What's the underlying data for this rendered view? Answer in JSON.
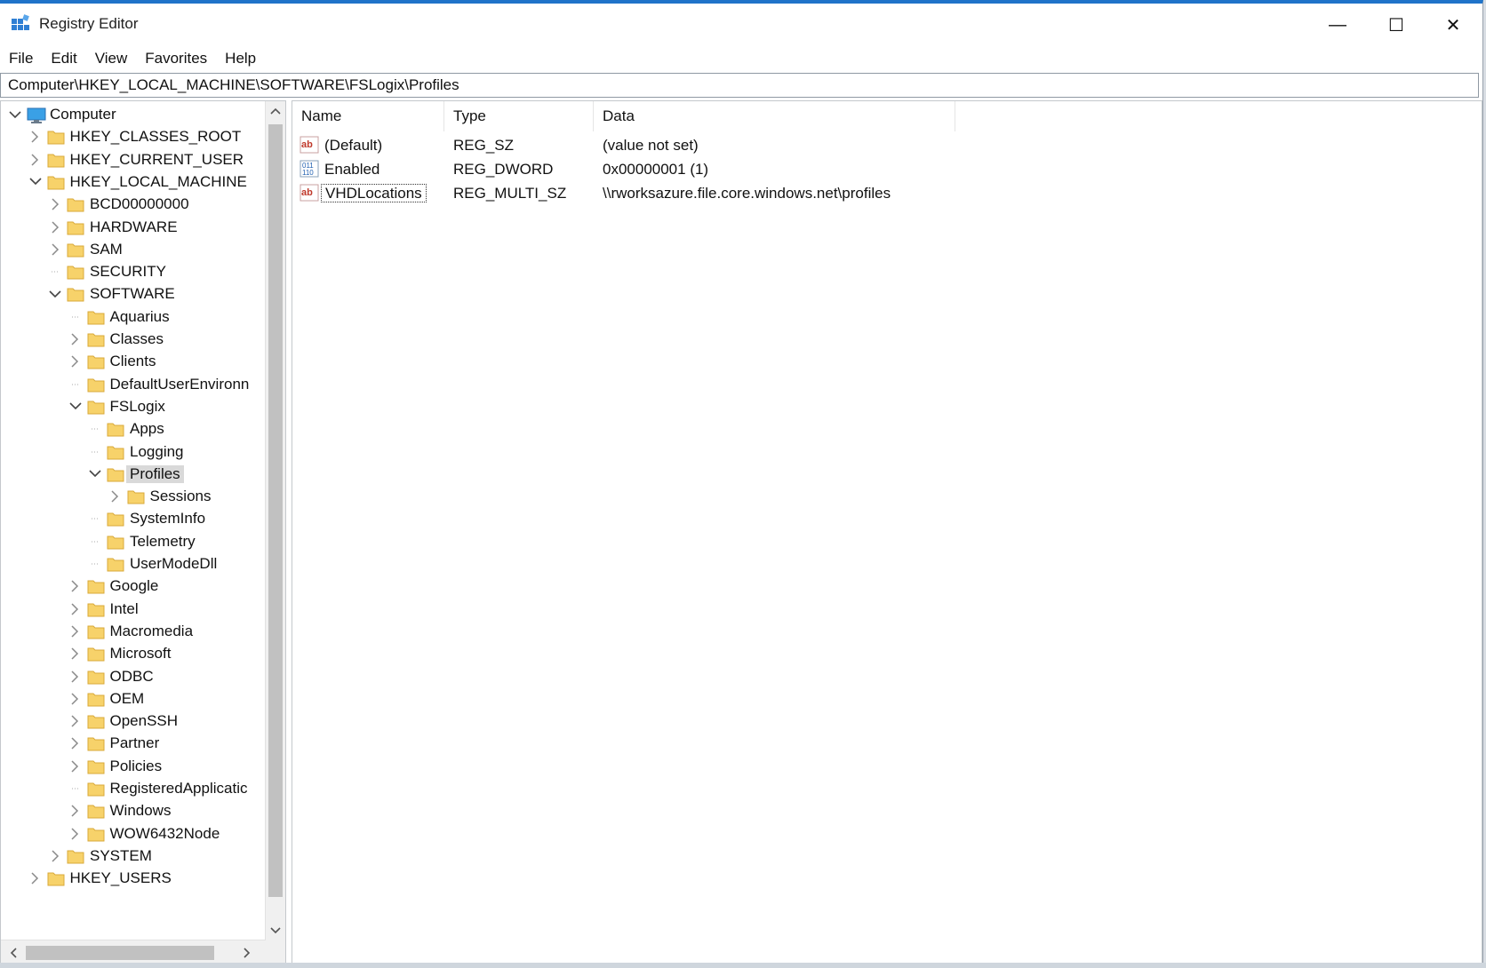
{
  "window": {
    "title": "Registry Editor",
    "controls": {
      "minimize": "—",
      "maximize": "☐",
      "close": "✕"
    }
  },
  "menu": [
    "File",
    "Edit",
    "View",
    "Favorites",
    "Help"
  ],
  "address": "Computer\\HKEY_LOCAL_MACHINE\\SOFTWARE\\FSLogix\\Profiles",
  "tree": [
    {
      "label": "Computer",
      "depth": 0,
      "state": "expanded",
      "icon": "computer-icon"
    },
    {
      "label": "HKEY_CLASSES_ROOT",
      "depth": 1,
      "state": "collapsed",
      "icon": "folder-icon"
    },
    {
      "label": "HKEY_CURRENT_USER",
      "depth": 1,
      "state": "collapsed",
      "icon": "folder-icon"
    },
    {
      "label": "HKEY_LOCAL_MACHINE",
      "depth": 1,
      "state": "expanded",
      "icon": "folder-icon"
    },
    {
      "label": "BCD00000000",
      "depth": 2,
      "state": "collapsed",
      "icon": "folder-icon"
    },
    {
      "label": "HARDWARE",
      "depth": 2,
      "state": "collapsed",
      "icon": "folder-icon"
    },
    {
      "label": "SAM",
      "depth": 2,
      "state": "collapsed",
      "icon": "folder-icon"
    },
    {
      "label": "SECURITY",
      "depth": 2,
      "state": "leaf",
      "icon": "folder-icon"
    },
    {
      "label": "SOFTWARE",
      "depth": 2,
      "state": "expanded",
      "icon": "folder-icon"
    },
    {
      "label": "Aquarius",
      "depth": 3,
      "state": "leaf",
      "icon": "folder-icon"
    },
    {
      "label": "Classes",
      "depth": 3,
      "state": "collapsed",
      "icon": "folder-icon"
    },
    {
      "label": "Clients",
      "depth": 3,
      "state": "collapsed",
      "icon": "folder-icon"
    },
    {
      "label": "DefaultUserEnvironn",
      "depth": 3,
      "state": "leaf",
      "icon": "folder-icon"
    },
    {
      "label": "FSLogix",
      "depth": 3,
      "state": "expanded",
      "icon": "folder-icon"
    },
    {
      "label": "Apps",
      "depth": 4,
      "state": "leaf",
      "icon": "folder-icon"
    },
    {
      "label": "Logging",
      "depth": 4,
      "state": "leaf",
      "icon": "folder-icon"
    },
    {
      "label": "Profiles",
      "depth": 4,
      "state": "expanded",
      "icon": "folder-icon",
      "selected": true
    },
    {
      "label": "Sessions",
      "depth": 5,
      "state": "collapsed",
      "icon": "folder-icon"
    },
    {
      "label": "SystemInfo",
      "depth": 4,
      "state": "leaf",
      "icon": "folder-icon"
    },
    {
      "label": "Telemetry",
      "depth": 4,
      "state": "leaf",
      "icon": "folder-icon"
    },
    {
      "label": "UserModeDll",
      "depth": 4,
      "state": "leaf",
      "icon": "folder-icon"
    },
    {
      "label": "Google",
      "depth": 3,
      "state": "collapsed",
      "icon": "folder-icon"
    },
    {
      "label": "Intel",
      "depth": 3,
      "state": "collapsed",
      "icon": "folder-icon"
    },
    {
      "label": "Macromedia",
      "depth": 3,
      "state": "collapsed",
      "icon": "folder-icon"
    },
    {
      "label": "Microsoft",
      "depth": 3,
      "state": "collapsed",
      "icon": "folder-icon"
    },
    {
      "label": "ODBC",
      "depth": 3,
      "state": "collapsed",
      "icon": "folder-icon"
    },
    {
      "label": "OEM",
      "depth": 3,
      "state": "collapsed",
      "icon": "folder-icon"
    },
    {
      "label": "OpenSSH",
      "depth": 3,
      "state": "collapsed",
      "icon": "folder-icon"
    },
    {
      "label": "Partner",
      "depth": 3,
      "state": "collapsed",
      "icon": "folder-icon"
    },
    {
      "label": "Policies",
      "depth": 3,
      "state": "collapsed",
      "icon": "folder-icon"
    },
    {
      "label": "RegisteredApplicatic",
      "depth": 3,
      "state": "leaf",
      "icon": "folder-icon"
    },
    {
      "label": "Windows",
      "depth": 3,
      "state": "collapsed",
      "icon": "folder-icon"
    },
    {
      "label": "WOW6432Node",
      "depth": 3,
      "state": "collapsed",
      "icon": "folder-icon"
    },
    {
      "label": "SYSTEM",
      "depth": 2,
      "state": "collapsed",
      "icon": "folder-icon"
    },
    {
      "label": "HKEY_USERS",
      "depth": 1,
      "state": "collapsed",
      "icon": "folder-icon"
    }
  ],
  "columns": {
    "name": "Name",
    "type": "Type",
    "data": "Data"
  },
  "values": [
    {
      "name": "(Default)",
      "type": "REG_SZ",
      "data": "(value not set)",
      "icon": "string-value-icon"
    },
    {
      "name": "Enabled",
      "type": "REG_DWORD",
      "data": "0x00000001 (1)",
      "icon": "binary-value-icon"
    },
    {
      "name": "VHDLocations",
      "type": "REG_MULTI_SZ",
      "data": "\\\\rworksazure.file.core.windows.net\\profiles",
      "icon": "string-value-icon",
      "focused": true
    }
  ],
  "colors": {
    "accent": "#1f73c9",
    "folder": "#f7d26a",
    "selection": "#d9d9d9"
  }
}
